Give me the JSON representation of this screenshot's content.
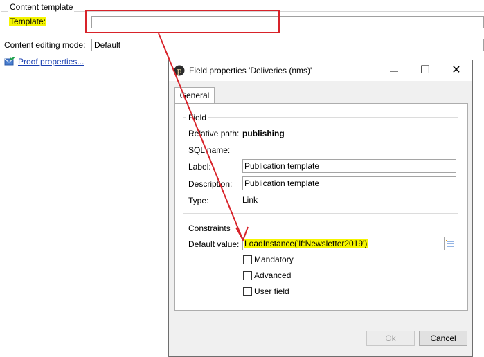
{
  "background": {
    "content_template_group": "Content template",
    "template_label": "Template:",
    "template_value": "",
    "content_editing_mode_label": "Content editing mode:",
    "content_editing_mode_value": "Default",
    "proof_properties_link": "Proof properties..."
  },
  "dialog": {
    "title": "Field properties  'Deliveries (nms)'",
    "controls": {
      "minimize": "—",
      "maximize": "☐",
      "close": "✕"
    },
    "tabs": [
      {
        "label": "General",
        "active": true
      }
    ],
    "field_group": {
      "title": "Field",
      "relative_path_label": "Relative path:",
      "relative_path_value": "publishing",
      "sql_name_label": "SQL name:",
      "sql_name_value": "",
      "label_label": "Label:",
      "label_value": "Publication template",
      "description_label": "Description:",
      "description_value": "Publication template",
      "type_label": "Type:",
      "type_value": "Link"
    },
    "constraints_group": {
      "title": "Constraints",
      "default_value_label": "Default value:",
      "default_value": "LoadInstance('lf:Newsletter2019')",
      "checkboxes": [
        {
          "label": "Mandatory",
          "checked": false
        },
        {
          "label": "Advanced",
          "checked": false
        },
        {
          "label": "User field",
          "checked": false
        }
      ]
    },
    "buttons": {
      "ok": "Ok",
      "cancel": "Cancel"
    }
  },
  "colors": {
    "highlight": "#f5f500",
    "annotation_red": "#d8232a",
    "link": "#1a3fb0"
  }
}
